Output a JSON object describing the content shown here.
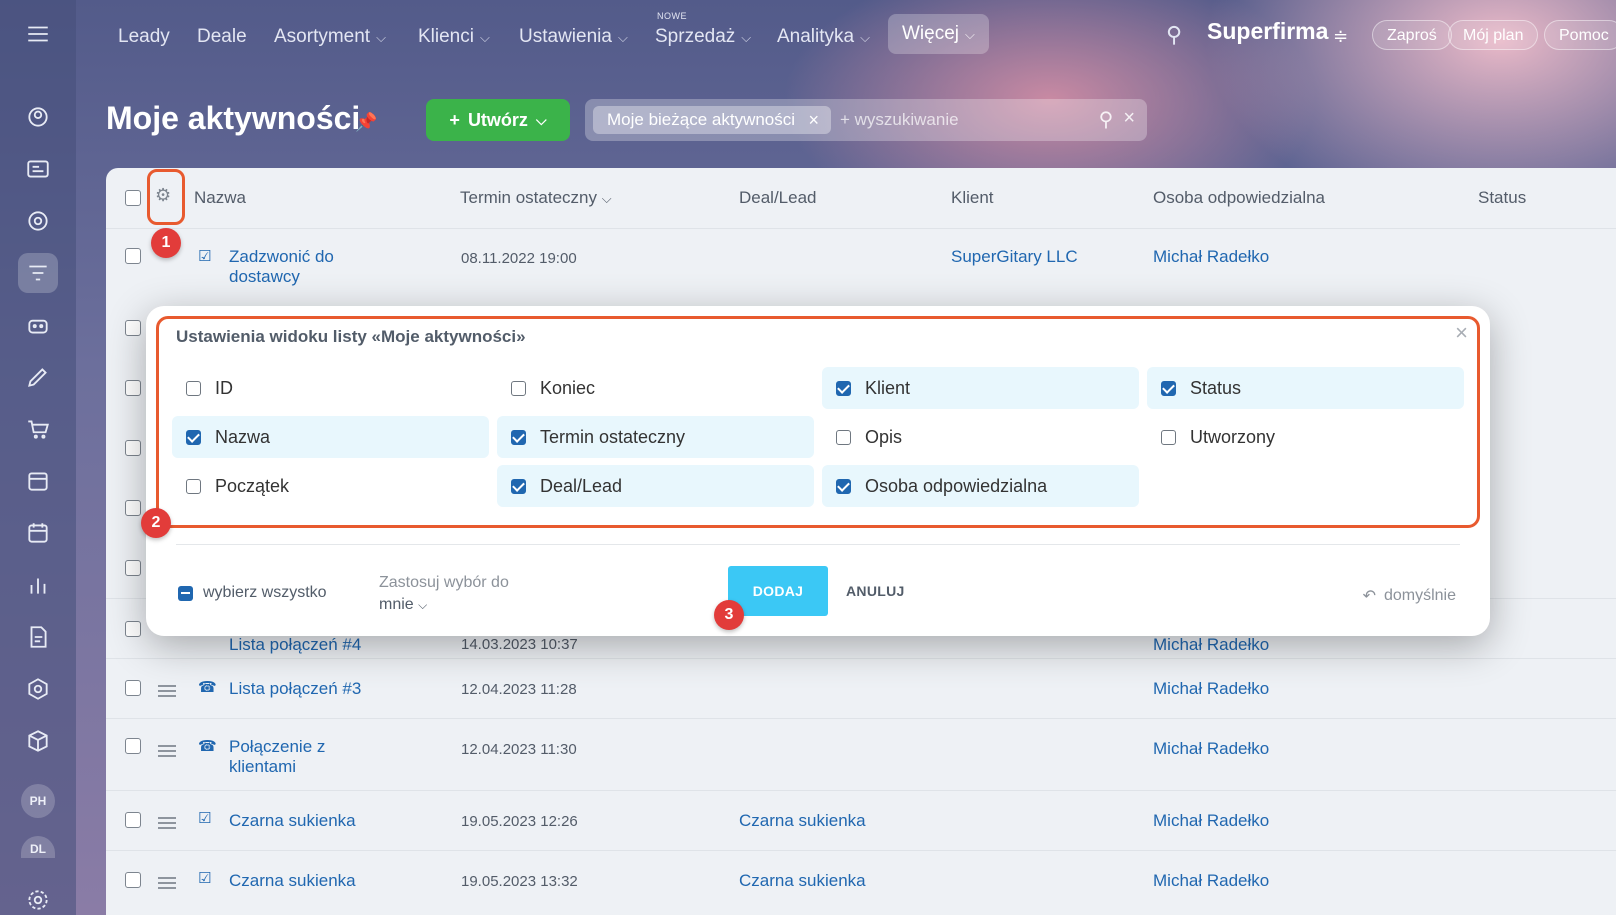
{
  "topnav": {
    "items": [
      {
        "label": "Leady",
        "dropdown": false
      },
      {
        "label": "Deale",
        "dropdown": false
      },
      {
        "label": "Asortyment",
        "dropdown": true
      },
      {
        "label": "Klienci",
        "dropdown": true
      },
      {
        "label": "Ustawienia",
        "dropdown": true
      },
      {
        "label": "Sprzedaż",
        "dropdown": true,
        "badge": "NOWE"
      },
      {
        "label": "Analityka",
        "dropdown": true
      },
      {
        "label": "Więcej",
        "dropdown": true,
        "active": true
      }
    ],
    "brand": "Superfirma",
    "buttons": [
      "Zaproś",
      "Mój plan",
      "Pomoc"
    ]
  },
  "sidebar": {
    "icons": [
      "menu-icon",
      "contacts-icon",
      "id-card-icon",
      "target-icon",
      "filter-icon",
      "robot-icon",
      "pen-icon",
      "cart-icon",
      "store-icon",
      "calendar-icon",
      "chart-icon",
      "document-icon",
      "hexagon-icon",
      "box-icon"
    ],
    "avatars": [
      "PH",
      "DL"
    ],
    "settings_icon": "gear-icon"
  },
  "header": {
    "title": "Moje aktywności",
    "create_label": "Utwórz",
    "filter_chip": "Moje bieżące aktywności",
    "search_placeholder": "+ wyszukiwanie"
  },
  "table": {
    "columns": [
      "Nazwa",
      "Termin ostateczny",
      "Deal/Lead",
      "Klient",
      "Osoba odpowiedzialna",
      "Status"
    ],
    "rows": [
      {
        "name": "Zadzwonić do dostawcy",
        "name_l2": "dostawcy",
        "name_l1": "Zadzwonić do",
        "date": "08.11.2022 19:00",
        "deal": "",
        "client": "SuperGitary LLC",
        "owner": "Michał Radełko",
        "icon": "task"
      },
      {
        "name_l1": "Lista połączeń #4",
        "name_l2": "",
        "date": "14.03.2023 10:37",
        "deal": "",
        "client": "",
        "owner": "Michał Radełko",
        "icon": "call"
      },
      {
        "name_l1": "Lista połączeń #3",
        "name_l2": "",
        "date": "12.04.2023 11:28",
        "deal": "",
        "client": "",
        "owner": "Michał Radełko",
        "icon": "call"
      },
      {
        "name_l1": "Połączenie z",
        "name_l2": "klientami",
        "date": "12.04.2023 11:30",
        "deal": "",
        "client": "",
        "owner": "Michał Radełko",
        "icon": "call"
      },
      {
        "name_l1": "Czarna sukienka",
        "name_l2": "",
        "date": "19.05.2023 12:26",
        "deal": "Czarna sukienka",
        "client": "",
        "owner": "Michał Radełko",
        "icon": "task"
      },
      {
        "name_l1": "Czarna sukienka",
        "name_l2": "",
        "date": "19.05.2023 13:32",
        "deal": "Czarna sukienka",
        "client": "",
        "owner": "Michał Radełko",
        "icon": "task"
      }
    ]
  },
  "modal": {
    "title": "Ustawienia widoku listy «Moje aktywności»",
    "options": [
      {
        "label": "ID",
        "checked": false
      },
      {
        "label": "Koniec",
        "checked": false
      },
      {
        "label": "Klient",
        "checked": true
      },
      {
        "label": "Status",
        "checked": true
      },
      {
        "label": "Nazwa",
        "checked": true
      },
      {
        "label": "Termin ostateczny",
        "checked": true
      },
      {
        "label": "Opis",
        "checked": false
      },
      {
        "label": "Utworzony",
        "checked": false
      },
      {
        "label": "Początek",
        "checked": false
      },
      {
        "label": "Deal/Lead",
        "checked": true
      },
      {
        "label": "Osoba odpowiedzialna",
        "checked": true
      }
    ],
    "select_all": "wybierz wszystko",
    "apply_label": "Zastosuj wybór do",
    "apply_value": "mnie",
    "add_label": "DODAJ",
    "cancel_label": "ANULUJ",
    "default_label": "domyślnie"
  },
  "badges": [
    "1",
    "2",
    "3"
  ],
  "colors": {
    "accent": "#3bc8f5",
    "highlight": "#e85a2f",
    "badge": "#e23c3a",
    "link": "#2067b0",
    "create": "#3bb34a"
  }
}
